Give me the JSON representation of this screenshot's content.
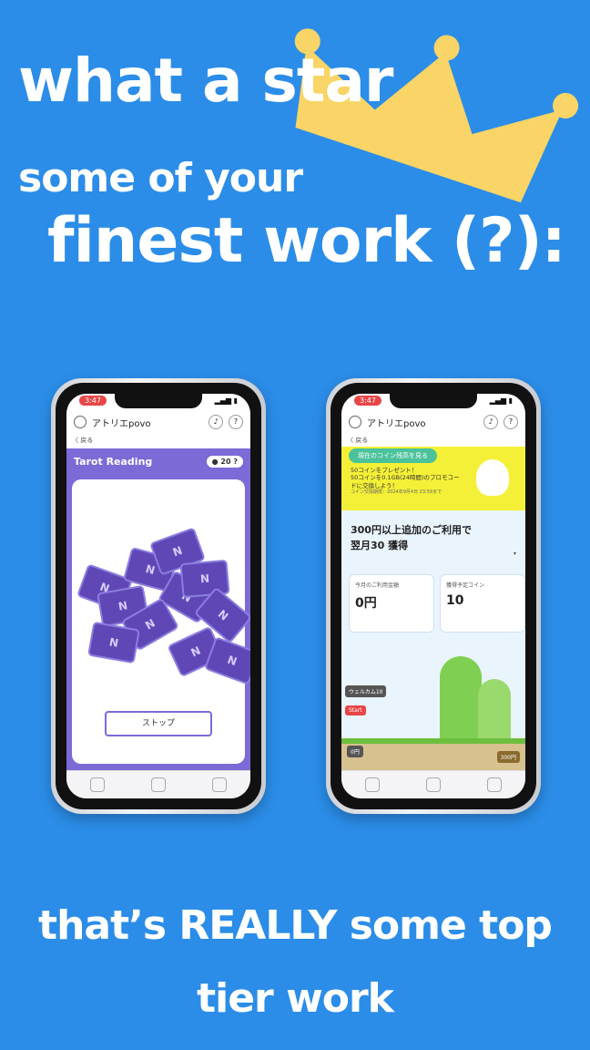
{
  "headline": {
    "line1": "what a star",
    "line2": "some of your",
    "line3": "finest work (?):"
  },
  "footer": {
    "line1": "that’s REALLY some top",
    "line2": "tier work"
  },
  "colors": {
    "background": "#2b8de8",
    "crown": "#f9d466",
    "tarot_purple": "#7c6ad6",
    "povo_yellow": "#f4f037"
  },
  "phone_left": {
    "time": "3:47",
    "app_title": "アトリエpovo",
    "back_label": "〈 戻る",
    "header_title": "Tarot Reading",
    "coin_count": "20",
    "stop_button": "ストップ",
    "tabs": [
      "",
      "",
      ""
    ]
  },
  "phone_right": {
    "time": "3:47",
    "app_title": "アトリエpovo",
    "back_label": "〈 戻る",
    "banner_pill": "現在のコイン残高を見る",
    "banner_line1": "50コインをプレゼント！",
    "banner_line2": "50コインを0.1GB(24時間)のプロモコードに交換しよう！",
    "banner_line3": "コイン交換期限：2024年9月4日 23:59まで",
    "offer_line1": "300円以上追加のご利用で",
    "offer_line2": "翌月30 獲得",
    "box1_label": "今月のご利用金額",
    "box1_value": "0円",
    "box2_label": "獲得予定コイン",
    "box2_value": "10",
    "welcome_tag": "ウェルカム10",
    "start_tag": "Start",
    "yen_tag": "0円",
    "yen_end": "300円"
  }
}
